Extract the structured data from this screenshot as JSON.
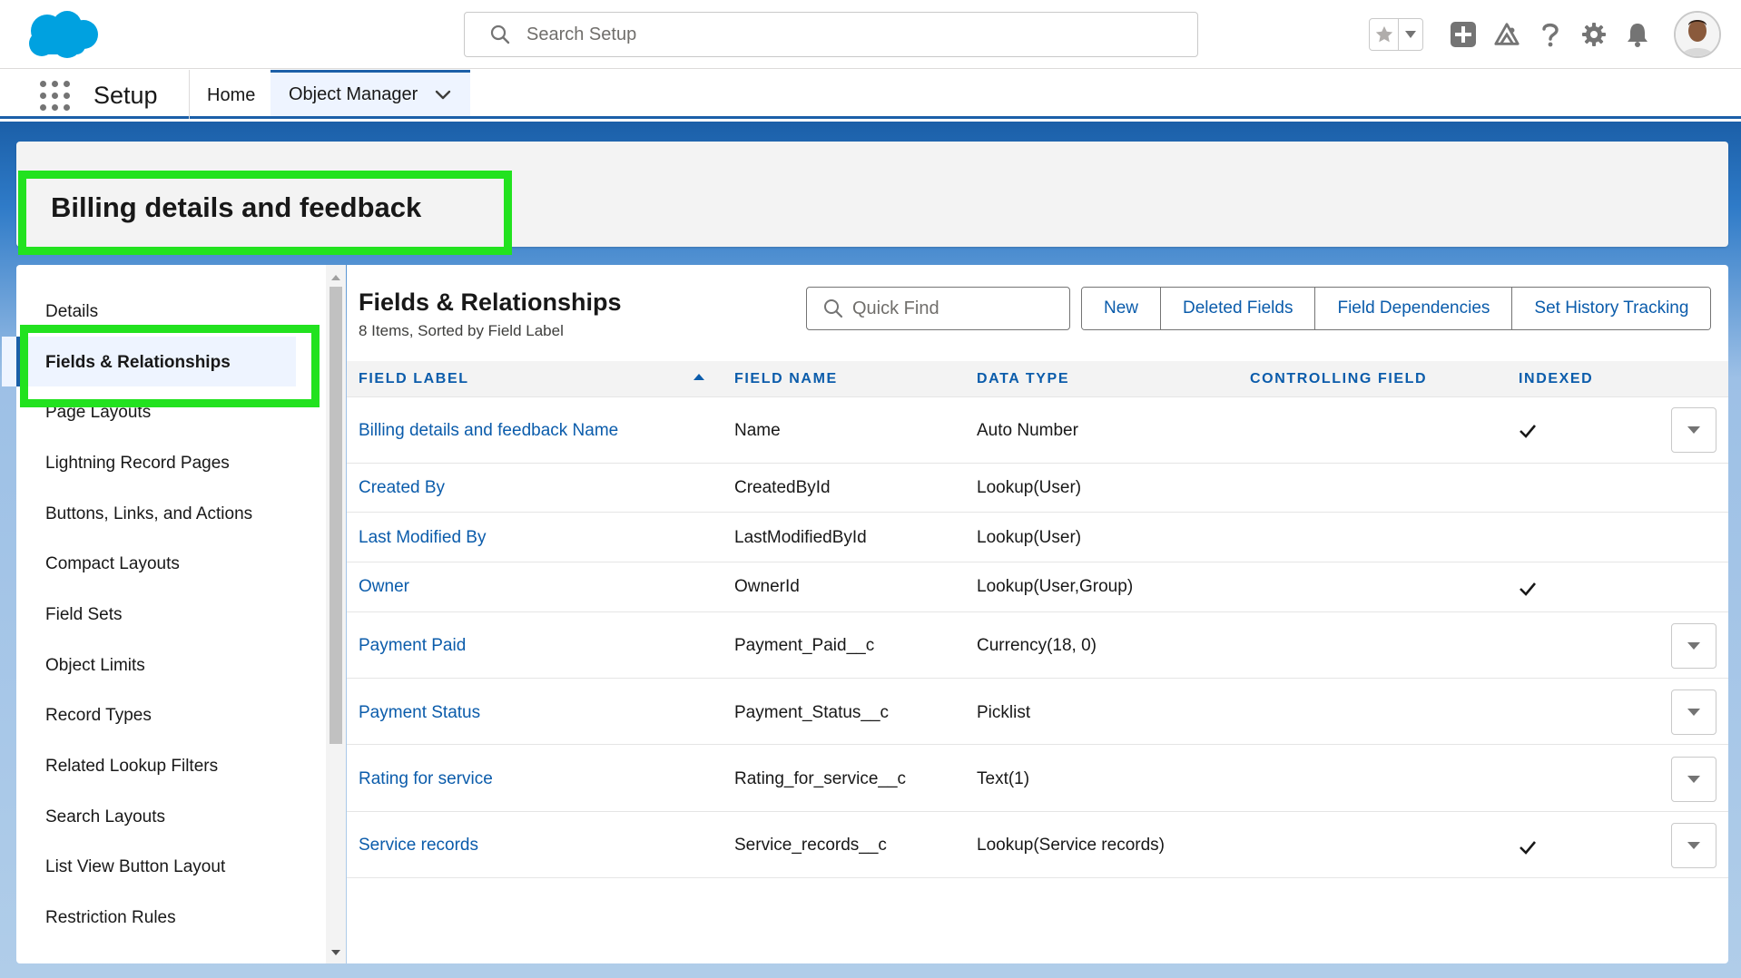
{
  "header": {
    "search_placeholder": "Search Setup"
  },
  "app_nav": {
    "app_name": "Setup",
    "home_tab": "Home",
    "object_manager_tab": "Object Manager"
  },
  "object": {
    "title": "Billing details and feedback"
  },
  "sidebar": {
    "items": [
      {
        "label": "Details"
      },
      {
        "label": "Fields & Relationships",
        "active": true
      },
      {
        "label": "Page Layouts"
      },
      {
        "label": "Lightning Record Pages"
      },
      {
        "label": "Buttons, Links, and Actions"
      },
      {
        "label": "Compact Layouts"
      },
      {
        "label": "Field Sets"
      },
      {
        "label": "Object Limits"
      },
      {
        "label": "Record Types"
      },
      {
        "label": "Related Lookup Filters"
      },
      {
        "label": "Search Layouts"
      },
      {
        "label": "List View Button Layout"
      },
      {
        "label": "Restriction Rules"
      }
    ]
  },
  "main": {
    "title": "Fields & Relationships",
    "subtitle": "8 Items, Sorted by Field Label",
    "quick_find_placeholder": "Quick Find",
    "buttons": {
      "new": "New",
      "deleted_fields": "Deleted Fields",
      "field_dependencies": "Field Dependencies",
      "set_history_tracking": "Set History Tracking"
    }
  },
  "table": {
    "columns": {
      "field_label": "FIELD LABEL",
      "field_name": "FIELD NAME",
      "data_type": "DATA TYPE",
      "controlling_field": "CONTROLLING FIELD",
      "indexed": "INDEXED"
    },
    "rows": [
      {
        "label": "Billing details and feedback Name",
        "name": "Name",
        "type": "Auto Number",
        "controlling": "",
        "indexed": true,
        "menu": true
      },
      {
        "label": "Created By",
        "name": "CreatedById",
        "type": "Lookup(User)",
        "controlling": "",
        "indexed": false,
        "menu": false
      },
      {
        "label": "Last Modified By",
        "name": "LastModifiedById",
        "type": "Lookup(User)",
        "controlling": "",
        "indexed": false,
        "menu": false
      },
      {
        "label": "Owner",
        "name": "OwnerId",
        "type": "Lookup(User,Group)",
        "controlling": "",
        "indexed": true,
        "menu": false
      },
      {
        "label": "Payment Paid",
        "name": "Payment_Paid__c",
        "type": "Currency(18, 0)",
        "controlling": "",
        "indexed": false,
        "menu": true
      },
      {
        "label": "Payment Status",
        "name": "Payment_Status__c",
        "type": "Picklist",
        "controlling": "",
        "indexed": false,
        "menu": true
      },
      {
        "label": "Rating for service",
        "name": "Rating_for_service__c",
        "type": "Text(1)",
        "controlling": "",
        "indexed": false,
        "menu": true
      },
      {
        "label": "Service records",
        "name": "Service_records__c",
        "type": "Lookup(Service records)",
        "controlling": "",
        "indexed": true,
        "menu": true
      }
    ]
  },
  "colors": {
    "brand_blue": "#1b5fa8",
    "link_blue": "#0b5cab",
    "highlight_green": "#22e21f",
    "logo_blue": "#00a1e0"
  }
}
